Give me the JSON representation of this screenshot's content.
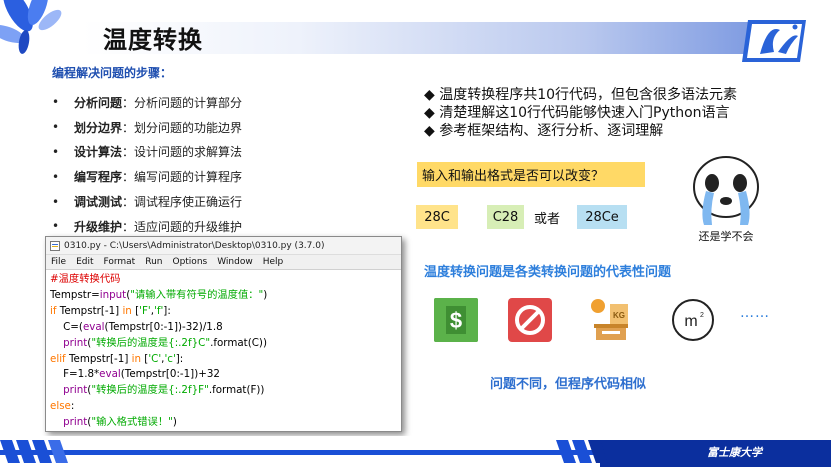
{
  "header": {
    "title": "温度转换"
  },
  "subtitle": "编程解决问题的步骤：",
  "steps": [
    {
      "keyword": "分析问题",
      "desc": "：分析问题的计算部分"
    },
    {
      "keyword": "划分边界",
      "desc": "：划分问题的功能边界"
    },
    {
      "keyword": "设计算法",
      "desc": "：设计问题的求解算法"
    },
    {
      "keyword": "编写程序",
      "desc": "：编写问题的计算程序"
    },
    {
      "keyword": "调试测试",
      "desc": "：调试程序使正确运行"
    },
    {
      "keyword": "升级维护",
      "desc": "：适应问题的升级维护"
    }
  ],
  "idle": {
    "title": "0310.py - C:\\Users\\Administrator\\Desktop\\0310.py (3.7.0)",
    "menu": [
      "File",
      "Edit",
      "Format",
      "Run",
      "Options",
      "Window",
      "Help"
    ]
  },
  "bullets": [
    "◆ 温度转换程序共10行代码，但包含很多语法元素",
    "◆ 清楚理解这10行代码能够快速入门Python语言",
    "◆ 参考框架结构、逐行分析、逐词理解"
  ],
  "question": "输入和输出格式是否可以改变？",
  "tags": [
    "28C",
    "C28",
    "28Ce"
  ],
  "or_text": "或者",
  "meme_caption": "还是学不会",
  "representative": "温度转换问题是各类转换问题的代表性问题",
  "dots": "……",
  "conclusion": "问题不同，但程序代码相似",
  "footer": {
    "university": "富士康大学"
  },
  "colors": {
    "accent_blue": "#1f4fb0",
    "question_bg": "#ffd966",
    "footer_blue": "#1a4fd6"
  }
}
